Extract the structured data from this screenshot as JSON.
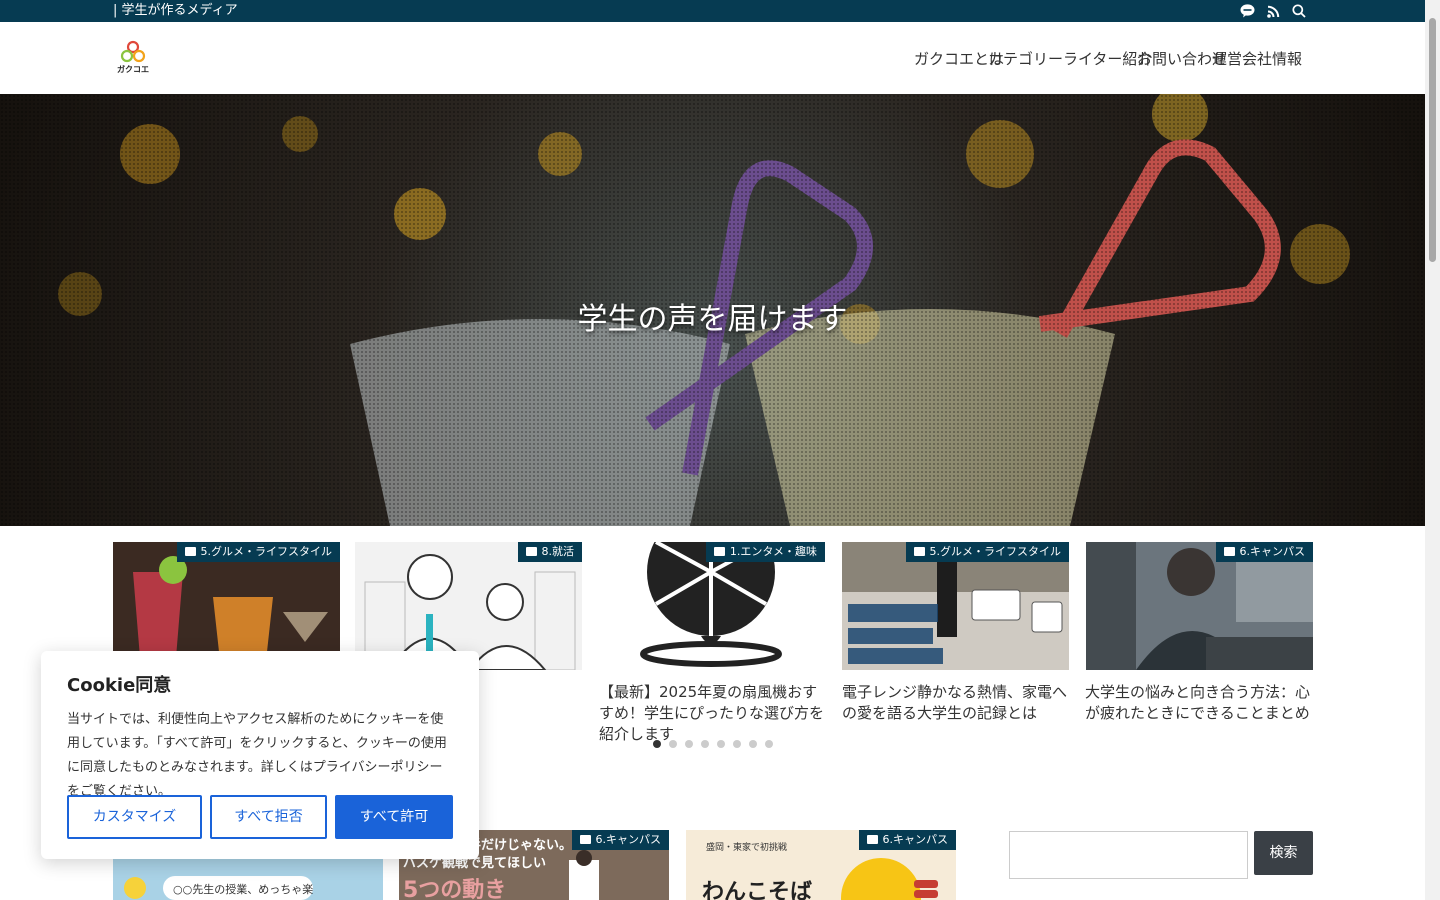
{
  "topbar": {
    "tagline": "| 学生が作るメディア"
  },
  "header": {
    "logo_text": "ガクコエ",
    "nav": [
      "ガクコエとは",
      "カテゴリー",
      "ライター紹介",
      "お問い合わせ",
      "運営会社情報"
    ]
  },
  "hero": {
    "title": "学生の声を届けます"
  },
  "slider": {
    "cards": [
      {
        "category": "5.グルメ・ライフスタイル",
        "title": ""
      },
      {
        "category": "8.就活",
        "title": ""
      },
      {
        "category": "1.エンタメ・趣味",
        "title": "【最新】2025年夏の扇風機おすすめ！学生にぴったりな選び方を紹介します"
      },
      {
        "category": "5.グルメ・ライフスタイル",
        "title": "電子レンジ静かなる熱情、家電への愛を語る大学生の記録とは"
      },
      {
        "category": "6.キャンパス",
        "title": "大学生の悩みと向き合う方法：心が疲れたときにできることまとめ"
      }
    ],
    "dots": 8,
    "active_dot": 0
  },
  "lower": {
    "cards": [
      {
        "category": "",
        "text1": "○○先生の授業、めっちゃ楽"
      },
      {
        "category": "6.キャンパス",
        "text1": "得点した選手だけじゃない。",
        "text2": "バスケ観戦で見てほしい",
        "text3": "5つの動き"
      },
      {
        "category": "6.キャンパス",
        "text1": "盛岡・東家で初挑戦",
        "text2": "わんこそば"
      }
    ]
  },
  "search": {
    "button": "検索",
    "placeholder": ""
  },
  "cookie": {
    "title": "Cookie同意",
    "body": "当サイトでは、利便性向上やアクセス解析のためにクッキーを使用しています。「すべて許可」をクリックすると、クッキーの使用に同意したものとみなされます。詳しくはプライバシーポリシーをご覧ください。",
    "customize": "カスタマイズ",
    "reject": "すべて拒否",
    "accept": "すべて許可"
  },
  "colors": {
    "brand": "#063b52",
    "primary": "#1a63d9",
    "search_button": "#3a4046"
  }
}
